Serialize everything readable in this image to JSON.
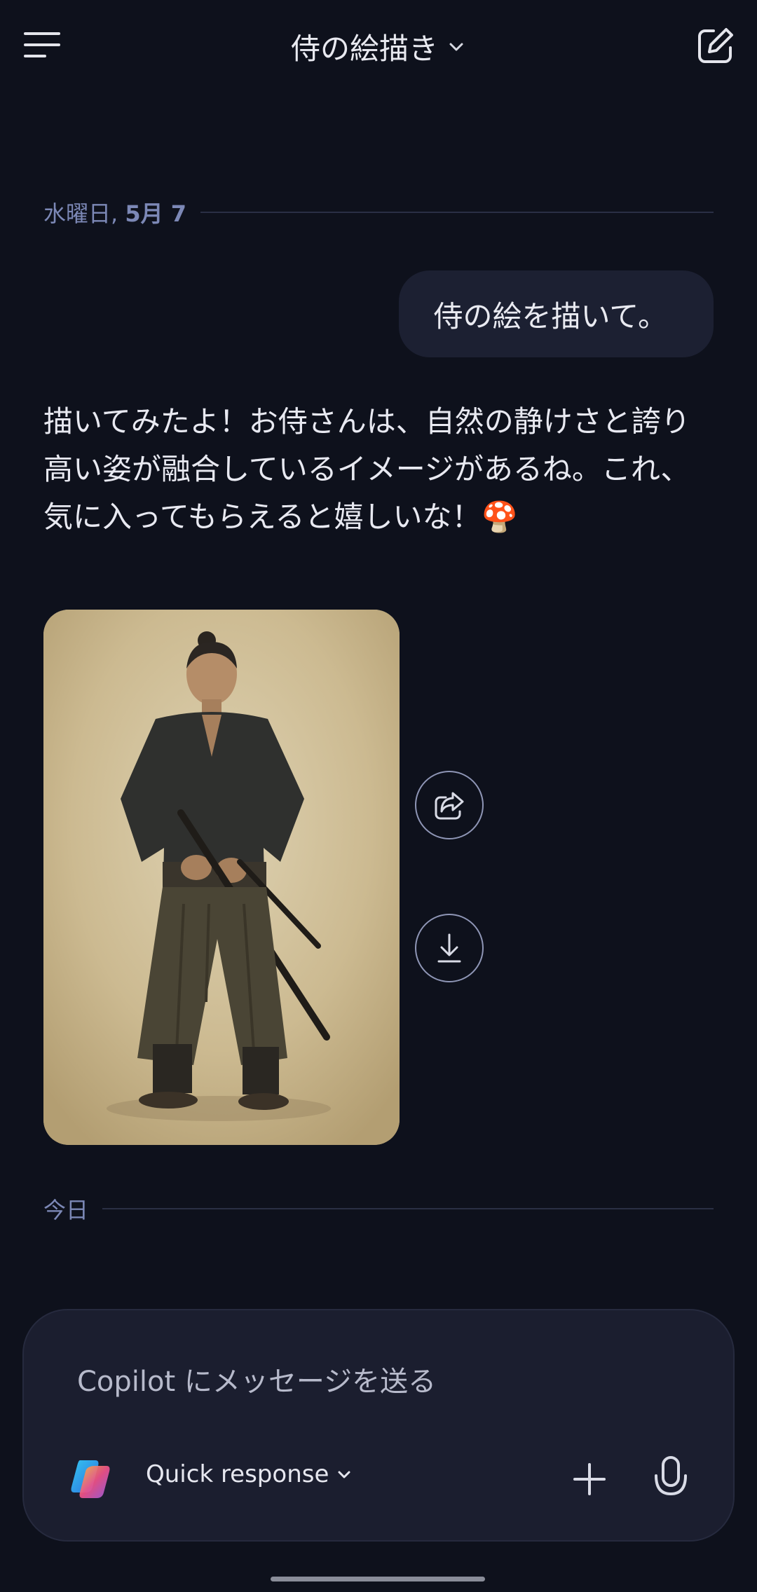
{
  "header": {
    "title": "侍の絵描き",
    "menu_icon": "hamburger-icon",
    "compose_icon": "new-chat-icon"
  },
  "dividers": {
    "first": {
      "weekday": "水曜日,",
      "date": "5月 7"
    },
    "second": {
      "label": "今日"
    }
  },
  "messages": {
    "user": "侍の絵を描いて。",
    "assistant": "描いてみたよ！お侍さんは、自然の静けさと誇り\n高い姿が融合しているイメージがあるね。これ、\n気に入ってもらえると嬉しいな！🍄"
  },
  "image_actions": {
    "share_icon": "share-icon",
    "download_icon": "download-icon"
  },
  "composer": {
    "placeholder": "Copilot にメッセージを送る",
    "mode": "Quick response",
    "plus_icon": "plus-icon",
    "mic_icon": "microphone-icon"
  },
  "colors": {
    "background": "#0e111c",
    "bubble": "#1c2032",
    "divider_text": "#7c88b6",
    "composer": "#1b1e2f"
  }
}
